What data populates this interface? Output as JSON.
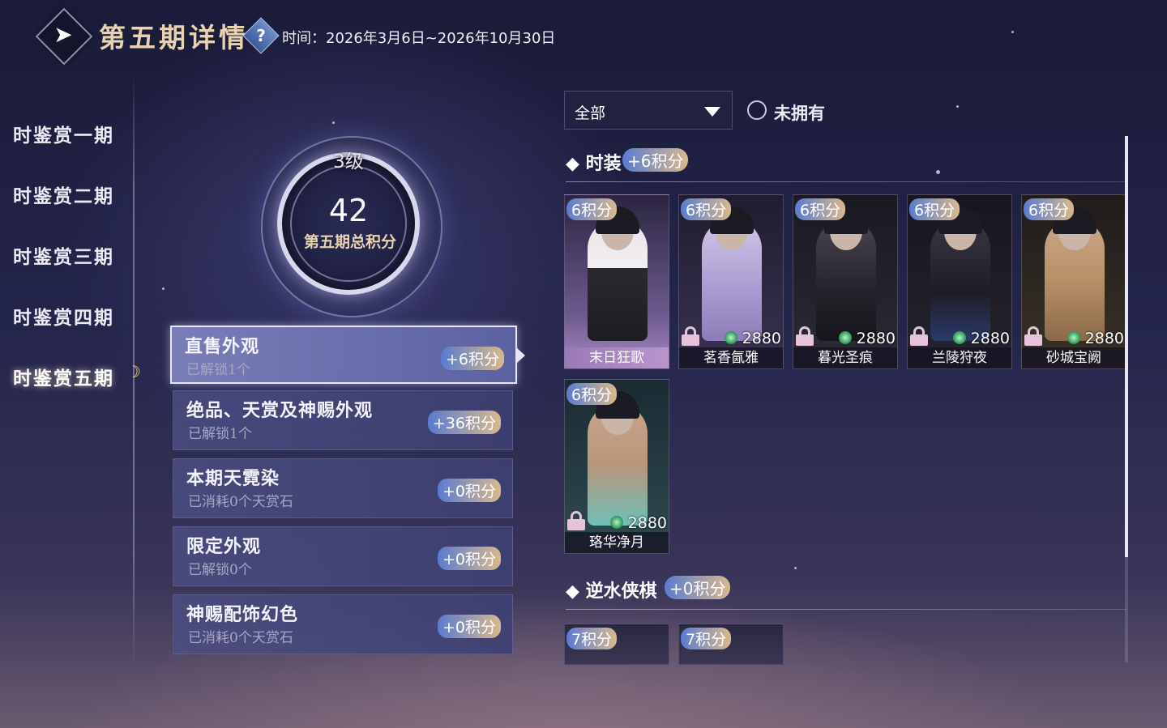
{
  "header": {
    "back_icon": "back-arrow-icon",
    "title": "第五期详情",
    "help_icon": "question-icon",
    "help_glyph": "?",
    "period": "时间：2026年3月6日~2026年10月30日"
  },
  "nav": {
    "items": [
      {
        "label": "时鉴赏一期"
      },
      {
        "label": "时鉴赏二期"
      },
      {
        "label": "时鉴赏三期"
      },
      {
        "label": "时鉴赏四期"
      },
      {
        "label": "时鉴赏五期"
      }
    ],
    "active_index": 4,
    "active_marker_icon": "crescent-ornament-icon"
  },
  "score": {
    "level": "3级",
    "value": "42",
    "label": "第五期总积分"
  },
  "categories": [
    {
      "title": "直售外观",
      "sub": "已解锁1个",
      "points": "+6积分"
    },
    {
      "title": "绝品、天赏及神赐外观",
      "sub": "已解锁1个",
      "points": "+36积分"
    },
    {
      "title": "本期天霓染",
      "sub": "已消耗0个天赏石",
      "points": "+0积分"
    },
    {
      "title": "限定外观",
      "sub": "已解锁0个",
      "points": "+0积分"
    },
    {
      "title": "神赐配饰幻色",
      "sub": "已消耗0个天赏石",
      "points": "+0积分"
    }
  ],
  "filter": {
    "dropdown_value": "全部",
    "radio_label": "未拥有"
  },
  "sections": [
    {
      "title": "时装",
      "points": "+6积分",
      "items": [
        {
          "badge": "6积分",
          "name": "末日狂歌",
          "owned": true
        },
        {
          "badge": "6积分",
          "name": "茗香氤雅",
          "price": "2880",
          "owned": false
        },
        {
          "badge": "6积分",
          "name": "暮光圣痕",
          "price": "2880",
          "owned": false
        },
        {
          "badge": "6积分",
          "name": "兰陵狩夜",
          "price": "2880",
          "owned": false
        },
        {
          "badge": "6积分",
          "name": "砂城宝阙",
          "price": "2880",
          "owned": false
        },
        {
          "badge": "6积分",
          "name": "珞华净月",
          "price": "2880",
          "owned": false
        }
      ]
    },
    {
      "title": "逆水侠棋",
      "points": "+0积分",
      "items": [
        {
          "badge": "7积分"
        },
        {
          "badge": "7积分"
        }
      ]
    }
  ],
  "colors": {
    "accent_gold": "#e8d2b0",
    "points_badge_start": "#5a7bd0",
    "points_badge_end": "#d8b98d",
    "background": "#24254b"
  }
}
